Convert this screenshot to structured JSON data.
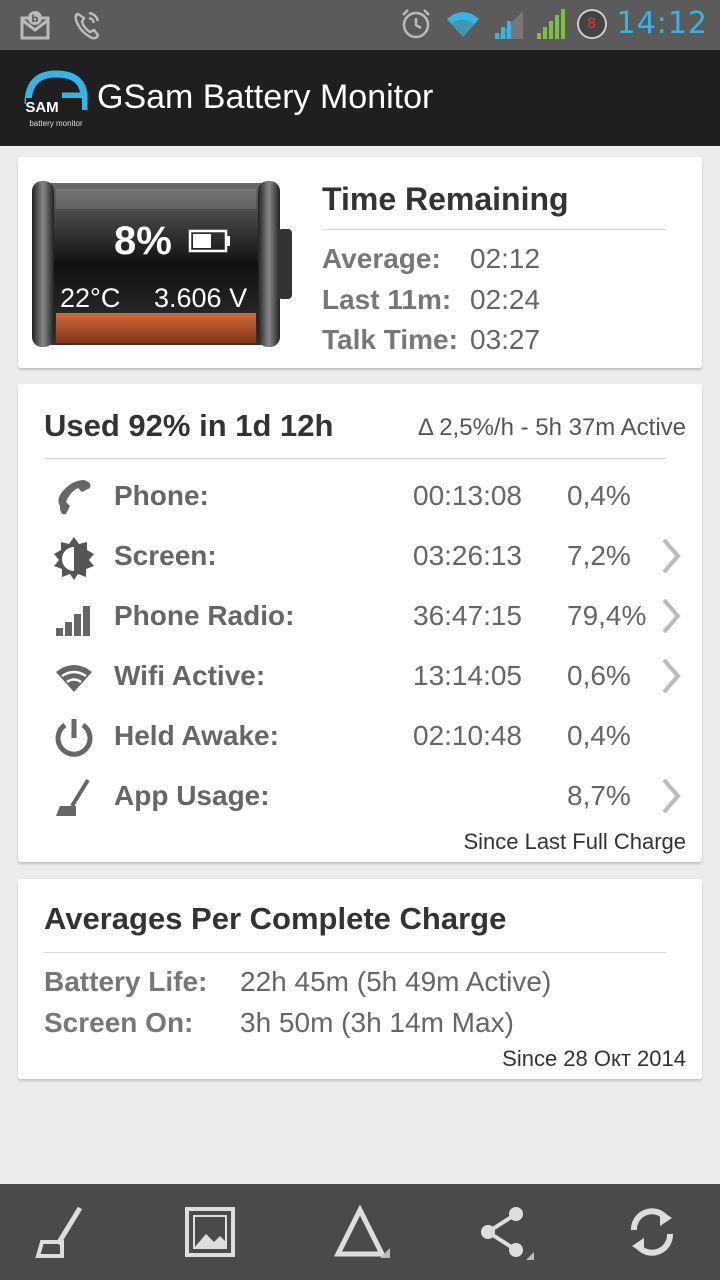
{
  "status_bar": {
    "time": "14:12",
    "notification_count": "8",
    "icons": [
      "mail-icon",
      "phone-call-icon",
      "alarm-icon",
      "wifi-icon",
      "signal-icon",
      "signal-icon"
    ]
  },
  "app": {
    "title": "GSam Battery Monitor",
    "logo_text": "SAM",
    "logo_subtext": "battery monitor"
  },
  "battery": {
    "percent": "8%",
    "temperature": "22°C",
    "voltage": "3.606 V",
    "level": 0.08
  },
  "time_remaining": {
    "title": "Time Remaining",
    "rows": [
      {
        "label": "Average:",
        "value": "02:12"
      },
      {
        "label": "Last 11m:",
        "value": "02:24"
      },
      {
        "label": "Talk Time:",
        "value": "03:27"
      }
    ]
  },
  "usage": {
    "title": "Used 92% in 1d 12h",
    "rate": "Δ 2,5%/h - 5h 37m Active",
    "rows": [
      {
        "icon": "phone-icon",
        "label": "Phone:",
        "time": "00:13:08",
        "percent": "0,4%",
        "chevron": false
      },
      {
        "icon": "screen-brightness-icon",
        "label": "Screen:",
        "time": "03:26:13",
        "percent": "7,2%",
        "chevron": true
      },
      {
        "icon": "signal-bars-icon",
        "label": "Phone Radio:",
        "time": "36:47:15",
        "percent": "79,4%",
        "chevron": true
      },
      {
        "icon": "wifi-icon",
        "label": "Wifi Active:",
        "time": "13:14:05",
        "percent": "0,6%",
        "chevron": true
      },
      {
        "icon": "power-icon",
        "label": "Held Awake:",
        "time": "02:10:48",
        "percent": "0,4%",
        "chevron": false
      },
      {
        "icon": "broom-icon",
        "label": "App Usage:",
        "time": "",
        "percent": "8,7%",
        "chevron": true
      }
    ],
    "since": "Since Last Full Charge"
  },
  "averages": {
    "title": "Averages Per Complete Charge",
    "rows": [
      {
        "label": "Battery Life:",
        "value": "22h 45m (5h 49m Active)"
      },
      {
        "label": "Screen On:",
        "value": "3h 50m (3h 14m Max)"
      }
    ],
    "since": "Since 28 Окт 2014"
  },
  "bottom_bar": {
    "buttons": [
      "broom-icon",
      "image-icon",
      "delta-icon",
      "share-icon",
      "refresh-icon"
    ]
  },
  "colors": {
    "clock": "#33b5e5",
    "actionbar": "#1f1f1f",
    "statusbar": "#5b5b5b",
    "bottombar": "#4a4a4a",
    "battery_fill": "#b8532a"
  }
}
